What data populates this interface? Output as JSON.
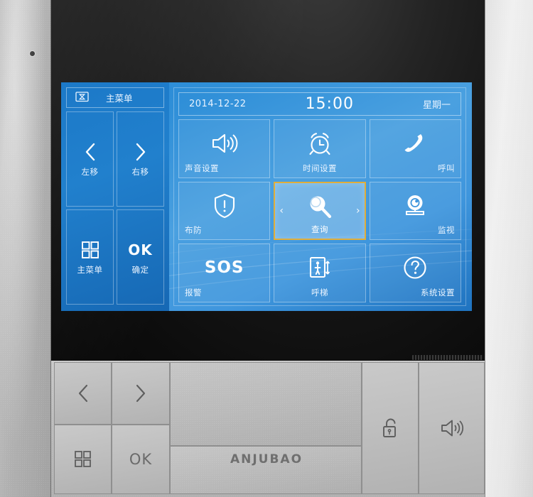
{
  "device": {
    "brand": "ANJUBAO",
    "mic_name": "microphone-pinhole",
    "speaker_grille_name": "speaker-grille"
  },
  "screen": {
    "nav": {
      "title_label": "主菜单",
      "title_icon": "screen-hourglass-icon",
      "buttons": [
        {
          "label": "左移",
          "icon": "chevron-left-icon"
        },
        {
          "label": "右移",
          "icon": "chevron-right-icon"
        },
        {
          "label": "主菜单",
          "icon": "grid-four-squares-icon"
        },
        {
          "label": "确定",
          "icon": "ok-text",
          "glyph": "OK"
        }
      ]
    },
    "statusbar": {
      "date": "2014-12-22",
      "time": "15:00",
      "weekday": "星期一"
    },
    "tiles": [
      {
        "label": "声音设置",
        "icon": "speaker-volume-icon",
        "selected": false,
        "column": "left"
      },
      {
        "label": "时间设置",
        "icon": "alarm-clock-icon",
        "selected": false,
        "column": "center"
      },
      {
        "label": "呼叫",
        "icon": "phone-handset-icon",
        "selected": false,
        "column": "right"
      },
      {
        "label": "布防",
        "icon": "shield-alert-icon",
        "selected": false,
        "column": "left"
      },
      {
        "label": "查询",
        "icon": "magnifier-search-icon",
        "selected": true,
        "column": "center",
        "prev_arrow": "‹",
        "next_arrow": "›"
      },
      {
        "label": "监视",
        "icon": "cctv-camera-icon",
        "selected": false,
        "column": "right"
      },
      {
        "label": "报警",
        "icon": "sos-text",
        "glyph": "SOS",
        "selected": false,
        "column": "left"
      },
      {
        "label": "呼梯",
        "icon": "elevator-call-icon",
        "selected": false,
        "column": "center"
      },
      {
        "label": "系统设置",
        "icon": "question-circle-icon",
        "selected": false,
        "column": "right"
      }
    ],
    "colors": {
      "screen_blue": "#2f8fd8",
      "nav_blue": "#1c79c8",
      "selection_gold": "#e0ae3a",
      "text_white": "#eaf4ff"
    }
  },
  "keypad": {
    "keys": [
      {
        "name": "hw-left-key",
        "glyph": "‹",
        "icon": "chevron-left-icon"
      },
      {
        "name": "hw-right-key",
        "glyph": "›",
        "icon": "chevron-right-icon"
      },
      {
        "name": "hw-menu-key",
        "glyph": "",
        "icon": "grid-four-squares-icon"
      },
      {
        "name": "hw-ok-key",
        "glyph": "OK",
        "icon": "ok-text"
      },
      {
        "name": "hw-unlock-key",
        "glyph": "",
        "icon": "padlock-unlock-icon"
      },
      {
        "name": "hw-speaker-key",
        "glyph": "",
        "icon": "speaker-volume-icon"
      }
    ]
  }
}
